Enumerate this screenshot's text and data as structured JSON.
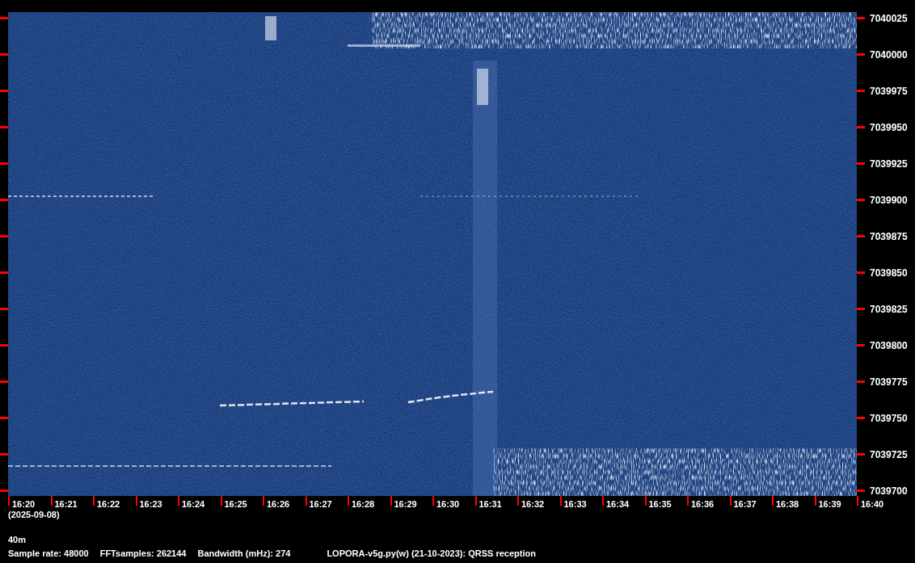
{
  "frequency_axis": {
    "labels": [
      "7040025",
      "7040000",
      "7039975",
      "7039950",
      "7039925",
      "7039900",
      "7039875",
      "7039850",
      "7039825",
      "7039800",
      "7039775",
      "7039750",
      "7039725",
      "7039700"
    ]
  },
  "time_axis": {
    "labels": [
      "16:20",
      "16:21",
      "16:22",
      "16:23",
      "16:24",
      "16:25",
      "16:26",
      "16:27",
      "16:28",
      "16:29",
      "16:30",
      "16:31",
      "16:32",
      "16:33",
      "16:34",
      "16:35",
      "16:36",
      "16:37",
      "16:38",
      "16:39",
      "16:40"
    ],
    "date": "(2025-09-08)"
  },
  "band": "40m",
  "info": [
    "Sample rate: 48000",
    "FFTsamples: 262144",
    "Bandwidth (mHz): 274",
    "LOPORA-v5g.py(w) (21-10-2023): QRSS reception"
  ]
}
